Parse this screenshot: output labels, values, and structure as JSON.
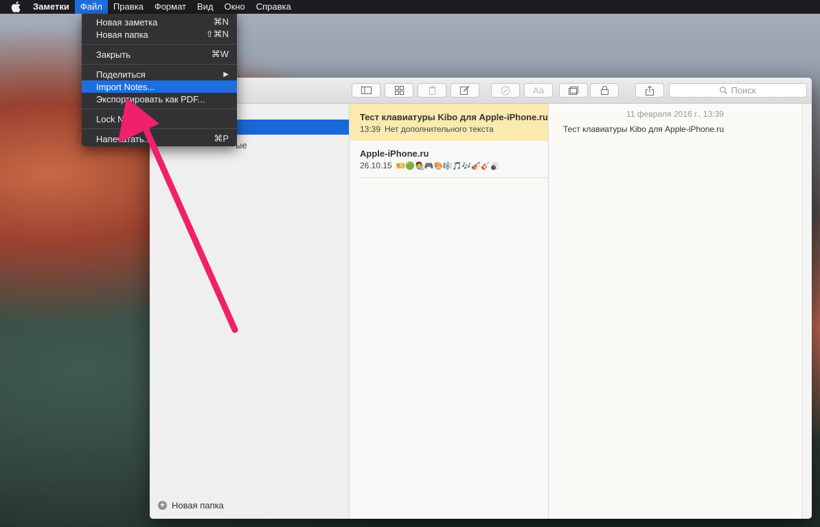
{
  "menubar": {
    "apple_icon": "apple-logo",
    "app_name": "Заметки",
    "items": [
      "Файл",
      "Правка",
      "Формат",
      "Вид",
      "Окно",
      "Справка"
    ]
  },
  "file_menu": {
    "items": [
      {
        "label": "Новая заметка",
        "shortcut": "⌘N"
      },
      {
        "label": "Новая папка",
        "shortcut": "⇧⌘N"
      },
      {
        "label": "Закрыть",
        "shortcut": "⌘W"
      },
      {
        "label": "Поделиться",
        "shortcut": "▶"
      },
      {
        "label": "Import Notes...",
        "shortcut": ""
      },
      {
        "label": "Экспортировать как PDF...",
        "shortcut": ""
      },
      {
        "label": "Lock Note",
        "shortcut": ""
      },
      {
        "label": "Напечатать...",
        "shortcut": "⌘P"
      }
    ]
  },
  "toolbar": {
    "search_placeholder": "Поиск"
  },
  "sidebar": {
    "partial_text": "ые",
    "new_folder_label": "Новая папка"
  },
  "notes": [
    {
      "title": "Тест клавиатуры Kibo для Apple-iPhone.ru",
      "date": "13:39",
      "preview": "Нет дополнительного текста"
    },
    {
      "title": "Apple-iPhone.ru",
      "date": "26.10.15",
      "preview": "🎫🟢🧑‍🎨🎮🎨🎼🎵🎶🎻🎸🎳"
    }
  ],
  "editor": {
    "date": "11 февраля 2016 г., 13:39",
    "body": "Тест клавиатуры Kibo для Apple-iPhone.ru"
  },
  "colors": {
    "accent": "#1f6ee0",
    "selected_note": "#faeab0",
    "arrow": "#f0206a"
  }
}
